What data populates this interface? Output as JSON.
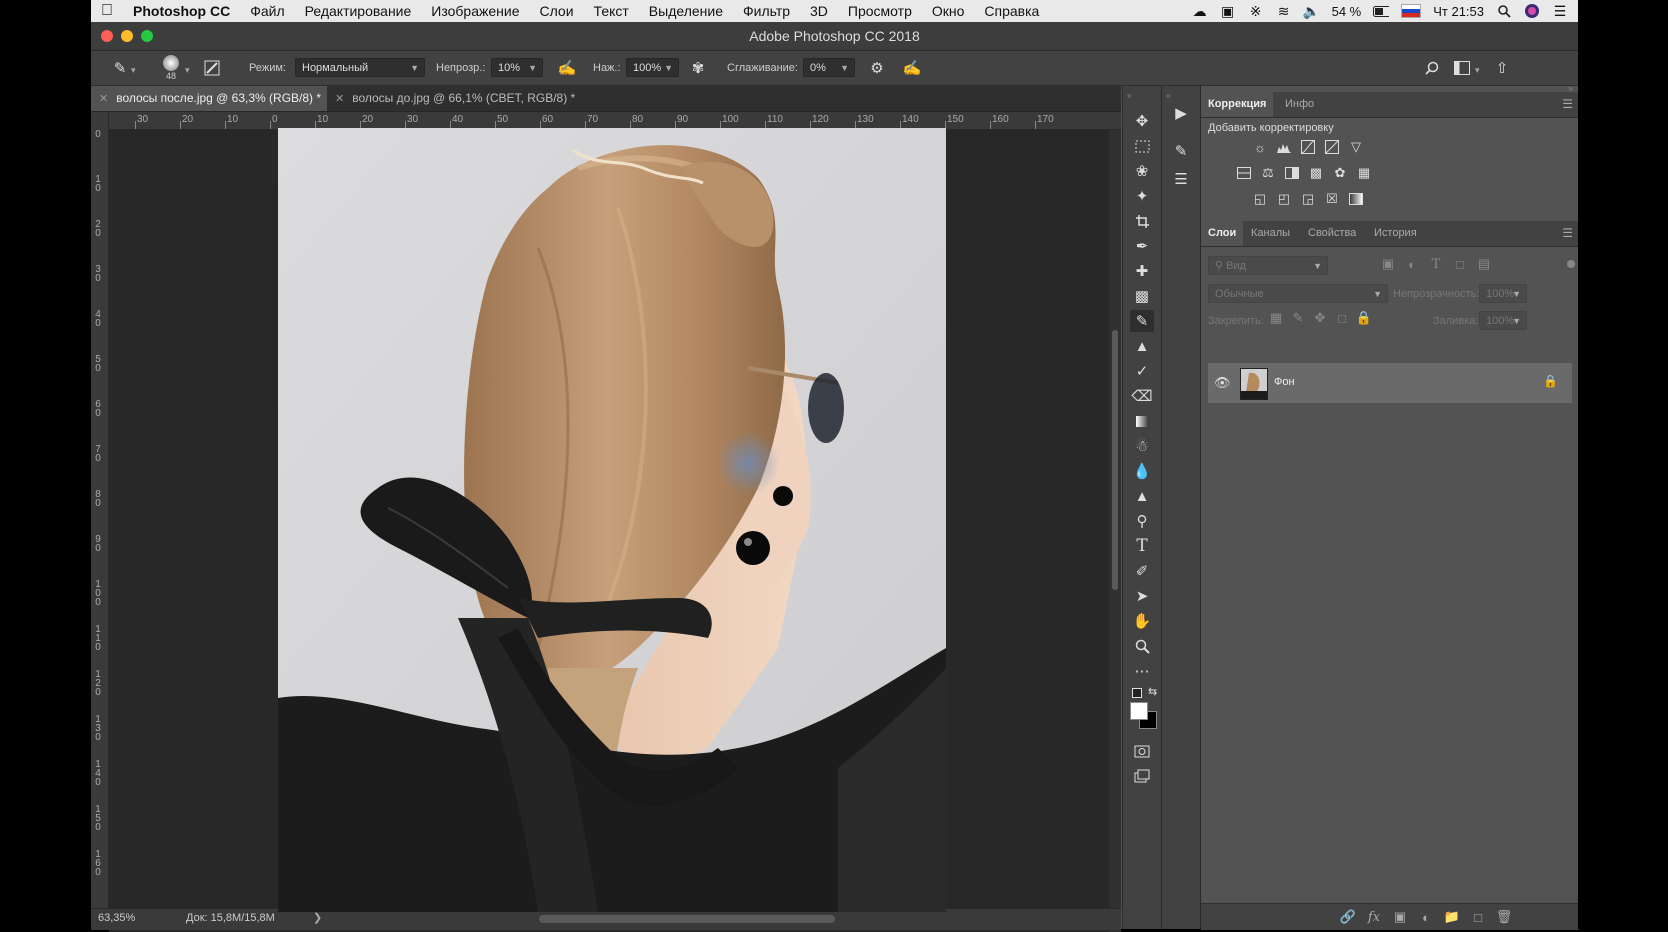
{
  "menubar": {
    "app_name": "Photoshop CC",
    "items": [
      "Файл",
      "Редактирование",
      "Изображение",
      "Слои",
      "Текст",
      "Выделение",
      "Фильтр",
      "3D",
      "Просмотр",
      "Окно",
      "Справка"
    ],
    "battery": "54 %",
    "clock": "Чт 21:53"
  },
  "window": {
    "title": "Adobe Photoshop CC 2018"
  },
  "options": {
    "brush_size": "48",
    "mode_label": "Режим:",
    "mode_value": "Нормальный",
    "opacity_label": "Непрозр.:",
    "opacity_value": "10%",
    "pressure_label": "Наж.:",
    "pressure_value": "100%",
    "smoothing_label": "Сглаживание:",
    "smoothing_value": "0%"
  },
  "tabs": [
    {
      "label": "волосы после.jpg @ 63,3% (RGB/8) *"
    },
    {
      "label": "волосы до.jpg @ 66,1% (CBET, RGB/8) *"
    }
  ],
  "ruler": {
    "top_labels": [
      "30",
      "20",
      "10",
      "0",
      "10",
      "20",
      "30",
      "40",
      "50",
      "60",
      "70",
      "80",
      "90",
      "100",
      "110",
      "120",
      "130",
      "140",
      "150",
      "160",
      "170"
    ],
    "left_labels": [
      "0",
      "1 0",
      "2 0",
      "3 0",
      "4 0",
      "5 0",
      "6 0",
      "7 0",
      "8 0",
      "9 0",
      "1 0 0",
      "1 1 0",
      "1 2 0",
      "1 3 0",
      "1 4 0",
      "1 5 0",
      "1 6 0"
    ]
  },
  "status": {
    "zoom": "63,35%",
    "doc": "Док: 15,8M/15,8M"
  },
  "adjust_panel": {
    "tabs": [
      "Коррекция",
      "Инфо"
    ],
    "heading": "Добавить корректировку"
  },
  "layers_panel": {
    "tabs": [
      "Слои",
      "Каналы",
      "Свойства",
      "История"
    ],
    "search_placeholder": "Вид",
    "blend_mode": "Обычные",
    "opacity_label": "Непрозрачность:",
    "opacity_value": "100%",
    "lock_label": "Закрепить:",
    "fill_label": "Заливка:",
    "fill_value": "100%",
    "layers": [
      {
        "name": "Фон",
        "visible": true,
        "locked": true
      }
    ]
  },
  "colors": {
    "close": "#fd5f57",
    "minimize": "#fdbc2e",
    "maximize": "#28c841"
  }
}
